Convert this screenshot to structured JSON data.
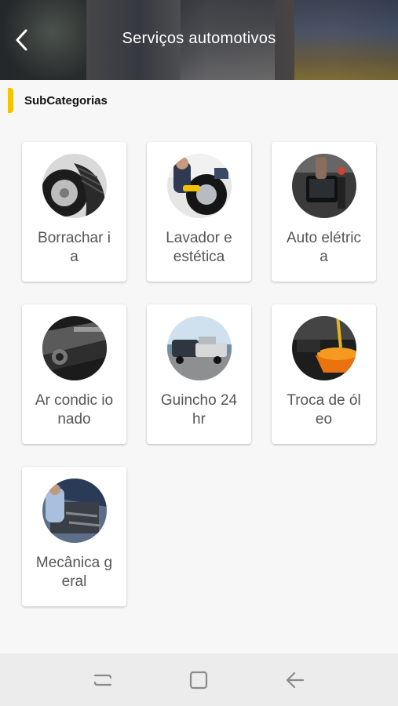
{
  "header": {
    "title": "Serviços automotivos",
    "back_icon": "chevron-left-icon"
  },
  "section": {
    "title": "SubCategorias",
    "accent_color": "#f5c400"
  },
  "categories": [
    {
      "label": "Borrachar ia",
      "icon": "tire-image"
    },
    {
      "label": "Lavador e estética",
      "icon": "car-wash-image"
    },
    {
      "label": "Auto elétrica",
      "icon": "auto-electric-image"
    },
    {
      "label": "Ar condic ionado",
      "icon": "air-conditioning-image"
    },
    {
      "label": "Guincho 24hr",
      "icon": "tow-truck-image"
    },
    {
      "label": "Troca de óleo",
      "icon": "oil-change-image"
    },
    {
      "label": "Mecânica geral",
      "icon": "general-mechanics-image"
    }
  ],
  "navbar": {
    "items": [
      "recents-icon",
      "home-icon",
      "back-icon"
    ]
  }
}
